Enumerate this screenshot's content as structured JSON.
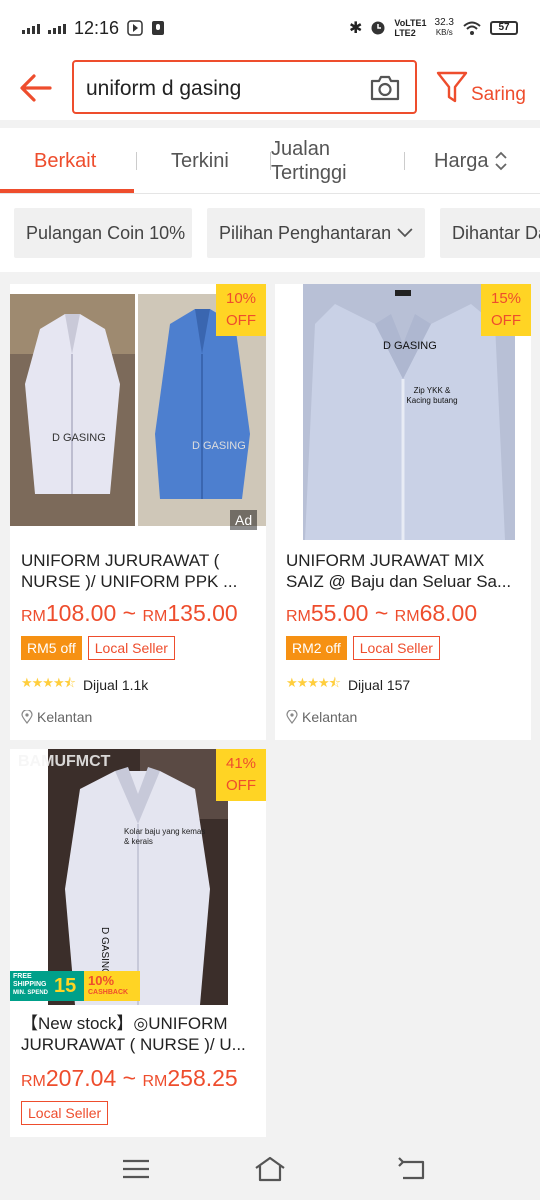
{
  "status_bar": {
    "time": "12:16",
    "lte1": "VoLTE1",
    "lte2": "LTE2",
    "speed": "32.3",
    "speed_unit": "KB/s",
    "battery": "57"
  },
  "search": {
    "query": "uniform d gasing",
    "filter_label": "Saring"
  },
  "tabs": [
    {
      "label": "Berkait",
      "active": true
    },
    {
      "label": "Terkini"
    },
    {
      "label": "Jualan Tertinggi"
    },
    {
      "label": "Harga"
    }
  ],
  "chips": [
    "Pulangan Coin 10%",
    "Pilihan Penghantaran",
    "Dihantar Da"
  ],
  "products": [
    {
      "title": "UNIFORM JURURAWAT ( NURSE )/ UNIFORM PPK ...",
      "discount_pct": "10%",
      "discount_word": "OFF",
      "ad": "Ad",
      "currency": "RM",
      "price_min": "108.00",
      "price_max": "135.00",
      "voucher": "RM5 off",
      "local": "Local Seller",
      "rating": 4.5,
      "sold": "Dijual 1.1k",
      "location": "Kelantan",
      "img_text": "D GASING",
      "img_text2": "D GASING"
    },
    {
      "title": "UNIFORM JURAWAT MIX SAIZ @ Baju dan Seluar Sa...",
      "discount_pct": "15%",
      "discount_word": "OFF",
      "currency": "RM",
      "price_min": "55.00",
      "price_max": "68.00",
      "voucher": "RM2 off",
      "local": "Local Seller",
      "rating": 4.5,
      "sold": "Dijual 157",
      "location": "Kelantan",
      "img_text": "D GASING",
      "img_note": "Zip YKK & Kacing butang"
    },
    {
      "title": "【New stock】◎UNIFORM JURURAWAT ( NURSE )/ U...",
      "discount_pct": "41%",
      "discount_word": "OFF",
      "currency": "RM",
      "price_min": "207.04",
      "price_max": "258.25",
      "local": "Local Seller",
      "img_watermark": "BAMUFMCT",
      "img_note": "Kolar baju yang kemas & kerais",
      "img_text": "D GASING",
      "promo_free_shipping": "FREE SHIPPING",
      "promo_min_spend": "MIN. SPEND",
      "promo_amount": "15",
      "promo_cashback_pct": "10%",
      "promo_cashback": "CASHBACK"
    }
  ],
  "colors": {
    "accent": "#ee4d2d",
    "discount_bg": "#ffd424",
    "voucher": "#f69113",
    "star": "#ffce3d"
  }
}
